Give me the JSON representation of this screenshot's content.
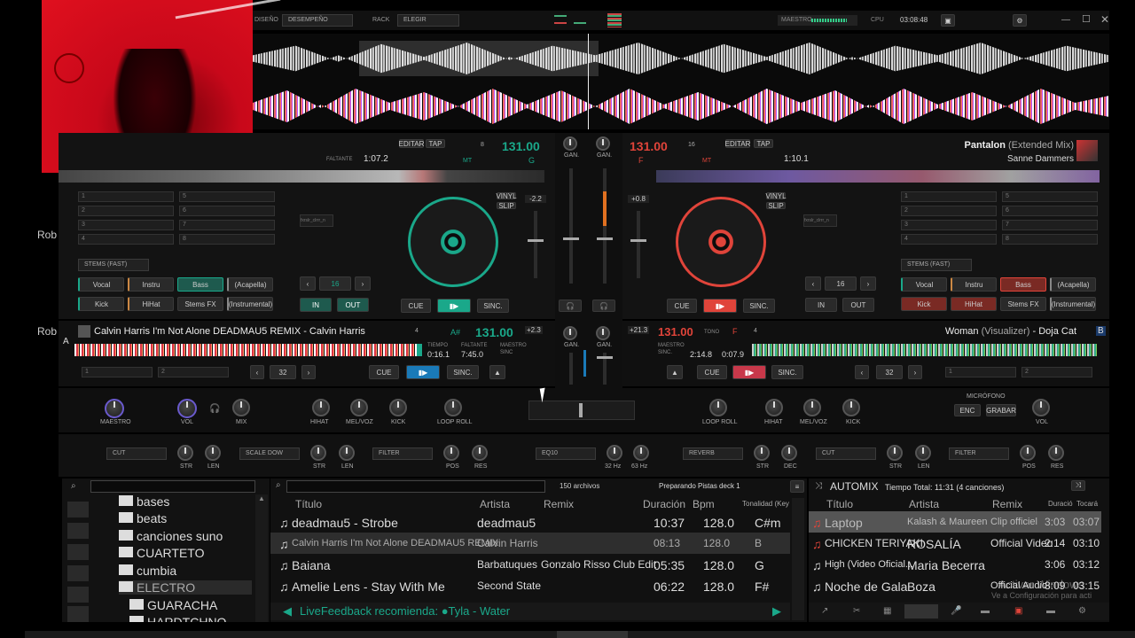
{
  "topbar": {
    "diseno": "DISEÑO",
    "layout": "DESEMPEÑO",
    "rack": "RACK",
    "rack_value": "ELEGIR",
    "master": "MAESTRO",
    "cpu": "CPU",
    "time": "03:08:48"
  },
  "deck1": {
    "title_bpm": "131.00",
    "key": "G",
    "editar": "EDITAR",
    "tap": "TAP",
    "beat": "8",
    "faltante": "FALTANTE",
    "remaining": "1:07.2",
    "mt": "MT",
    "tono": "TONO",
    "maestro": "MAESTRO",
    "sinc": "SINC.",
    "pitch": "-2.2",
    "vinyl": "VINYL",
    "slip": "SLIP",
    "cue": "CUE",
    "sync": "SINC.",
    "loop": "16",
    "in": "IN",
    "out": "OUT",
    "stems": "STEMS (FAST)",
    "hotcues": [
      "1",
      "2",
      "3",
      "4",
      "5",
      "6",
      "7",
      "8"
    ],
    "stem_btns": [
      "Vocal",
      "Instru",
      "Bass",
      "(Acapella)",
      "Kick",
      "HiHat",
      "Stems FX",
      "(Instrumental)"
    ],
    "sampler": "fxrslr_clrrr_n"
  },
  "deck2": {
    "title": "Pantalon",
    "title_mix": "(Extended Mix)",
    "artist": "Sanne Dammers",
    "bpm": "131.00",
    "beat": "16",
    "key": "F",
    "editar": "EDITAR",
    "tap": "TAP",
    "remaining": "1:10.1",
    "mt": "MT",
    "maestro": "MAESTRO",
    "sinc": "SINC.",
    "pitch": "+0.8",
    "vinyl": "VINYL",
    "slip": "SLIP",
    "cue": "CUE",
    "sync": "SINC.",
    "loop": "16",
    "in": "IN",
    "out": "OUT",
    "stems": "STEMS (FAST)",
    "hotcues": [
      "1",
      "2",
      "3",
      "4",
      "5",
      "6",
      "7",
      "8"
    ],
    "stem_btns": [
      "Vocal",
      "Instru",
      "Bass",
      "(Acapella)",
      "Kick",
      "HiHat",
      "Stems FX",
      "(Instrumental)"
    ],
    "sampler": "fxrslr_clrrr_n"
  },
  "deckA": {
    "letter": "A",
    "title": "Calvin Harris I'm Not Alone DEADMAU5 REMIX - Calvin Harris",
    "beat": "4",
    "key": "A#",
    "bpm": "131.00",
    "tiempo": "TIEMPO",
    "elapsed": "0:16.1",
    "faltante": "FALTANTE",
    "remaining": "7:45.0",
    "maestro": "MAESTRO",
    "sinc": "SINC",
    "pitch": "+2.3",
    "slot1": "1",
    "slot2": "2",
    "loop": "32",
    "cue": "CUE",
    "sync": "SINC."
  },
  "deckB": {
    "letter": "B",
    "title": "Woman",
    "title_mix": "(Visualizer)",
    "artist": "Doja Cat",
    "bpm": "131.00",
    "tono": "TONO",
    "key": "F",
    "beat": "4",
    "elapsed": "2:14.8",
    "remaining": "0:07.9",
    "maestro": "MAESTRO",
    "sinc": "SINC.",
    "pitch": "+21.3",
    "slot1": "1",
    "slot2": "2",
    "loop": "32",
    "cue": "CUE",
    "sync": "SINC."
  },
  "mixer": {
    "gan": "GAN.",
    "maestro": "MAESTRO",
    "vol": "VOL",
    "mix": "MIX",
    "hihat": "HIHAT",
    "melvoz": "MEL/VOZ",
    "kick": "KICK",
    "loop_roll": "LOOP ROLL",
    "microfono": "MICRÓFONO",
    "enc": "ENC",
    "grabar": "GRABAR"
  },
  "fxbar": {
    "fx1": "CUT",
    "fx2": "SCALE DOW",
    "fx3": "FILTER",
    "eq": "EQ10",
    "fx4": "REVERB",
    "fx5": "CUT",
    "fx6": "FILTER",
    "str": "STR",
    "len": "LEN",
    "pos": "POS",
    "res": "RES",
    "hz32": "32 Hz",
    "hz63": "63 Hz",
    "dec": "DEC"
  },
  "sidebar": {
    "folders": [
      "bases",
      "beats",
      "canciones suno",
      "CUARTETO",
      "cumbia",
      "ELECTRO",
      "GUARACHA",
      "HARDTCHNO"
    ]
  },
  "browser": {
    "count": "150 archivos",
    "status": "Preparando Pistas deck 1",
    "cols": {
      "title": "Título",
      "artist": "Artista",
      "remix": "Remix",
      "duration": "Duración",
      "bpm": "Bpm",
      "key": "Tonalidad (Key"
    },
    "rows": [
      {
        "title": "deadmau5 - Strobe",
        "artist": "deadmau5",
        "remix": "",
        "duration": "10:37",
        "bpm": "128.0",
        "key": "C#m"
      },
      {
        "title": "Calvin Harris I'm Not Alone DEADMAU5 REMIX",
        "artist": "Calvin Harris",
        "remix": "",
        "duration": "08:13",
        "bpm": "128.0",
        "key": "B"
      },
      {
        "title": "Baiana",
        "artist": "Barbatuques",
        "remix": "Gonzalo Risso Club Edit",
        "duration": "05:35",
        "bpm": "128.0",
        "key": "G"
      },
      {
        "title": "Amelie Lens - Stay With Me",
        "artist": "Second State",
        "remix": "",
        "duration": "06:22",
        "bpm": "128.0",
        "key": "F#"
      }
    ],
    "recommend": "LiveFeedback recomienda: ●Tyla - Water"
  },
  "automix": {
    "title": "AUTOMIX",
    "total": "Tiempo Total: 11:31 (4 canciones)",
    "cols": {
      "title": "Título",
      "artist": "Artista",
      "remix": "Remix",
      "duration": "Duració",
      "played": "Tocará"
    },
    "rows": [
      {
        "title": "Laptop",
        "artist": "Kalash & Maureen",
        "remix": "Clip officiel",
        "duration": "3:03",
        "played": "03:07"
      },
      {
        "title": "CHICKEN TERIYAKI",
        "artist": "ROSALÍA",
        "remix": "Official Video",
        "duration": "2:14",
        "played": "03:10"
      },
      {
        "title": "High (Video Oficial...",
        "artist": "Maria Becerra",
        "remix": "",
        "duration": "3:06",
        "played": "03:12"
      },
      {
        "title": "Noche de Gala",
        "artist": "Boza",
        "remix": "Official Audio",
        "duration": "3:09",
        "played": "03:15"
      }
    ],
    "watermark1": "Activar Windows",
    "watermark2": "Ve a Configuración para acti"
  },
  "side_labels": {
    "rob1": "Rob",
    "rob2": "Rob"
  },
  "colors": {
    "teal": "#1aa88a",
    "red": "#e0443a",
    "pink": "#e84a6a"
  }
}
